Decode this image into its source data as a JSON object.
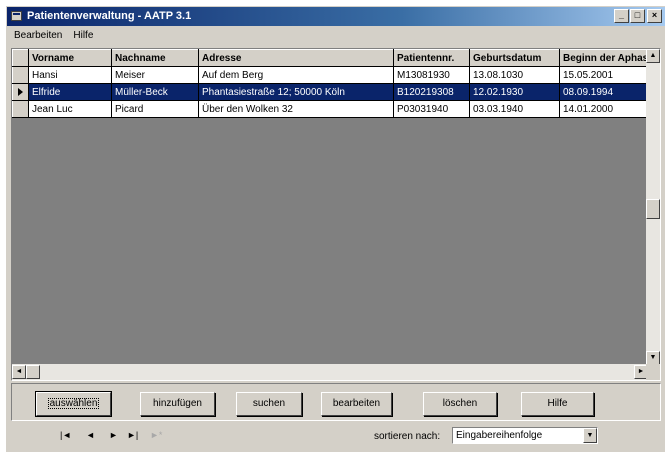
{
  "window": {
    "title": "Patientenverwaltung - AATP 3.1",
    "controls": {
      "minimize": "_",
      "maximize": "□",
      "close": "×"
    }
  },
  "menu": {
    "items": [
      "Bearbeiten",
      "Hilfe"
    ]
  },
  "grid": {
    "columns": [
      "Vorname",
      "Nachname",
      "Adresse",
      "Patientennr.",
      "Geburtsdatum",
      "Beginn der Aphas"
    ],
    "rows": [
      {
        "vorname": "Hansi",
        "nachname": "Meiser",
        "adresse": "Auf dem Berg",
        "patientennr": "M13081930",
        "geburtsdatum": "13.08.1030",
        "beginn": "15.05.2001",
        "selected": false
      },
      {
        "vorname": "Elfride",
        "nachname": "Müller-Beck",
        "adresse": "Phantasiestraße 12; 50000 Köln",
        "patientennr": "B120219308",
        "geburtsdatum": "12.02.1930",
        "beginn": "08.09.1994",
        "selected": true
      },
      {
        "vorname": "Jean Luc",
        "nachname": "Picard",
        "adresse": "Über den Wolken 32",
        "patientennr": "P03031940",
        "geburtsdatum": "03.03.1940",
        "beginn": "14.01.2000",
        "selected": false
      }
    ]
  },
  "buttons": {
    "auswaehlen": "auswählen",
    "hinzufuegen": "hinzufügen",
    "suchen": "suchen",
    "bearbeiten": "bearbeiten",
    "loeschen": "löschen",
    "hilfe": "Hilfe"
  },
  "navigation": {
    "first": "|◄",
    "prev": "◄",
    "next": "►",
    "last": "►|",
    "new": "►*"
  },
  "sort": {
    "label": "sortieren nach:",
    "selected": "Eingabereihenfolge"
  },
  "colors": {
    "title_start": "#0a246a",
    "title_end": "#a6caf0",
    "selection": "#0a246a",
    "face": "#d4d0c8"
  }
}
